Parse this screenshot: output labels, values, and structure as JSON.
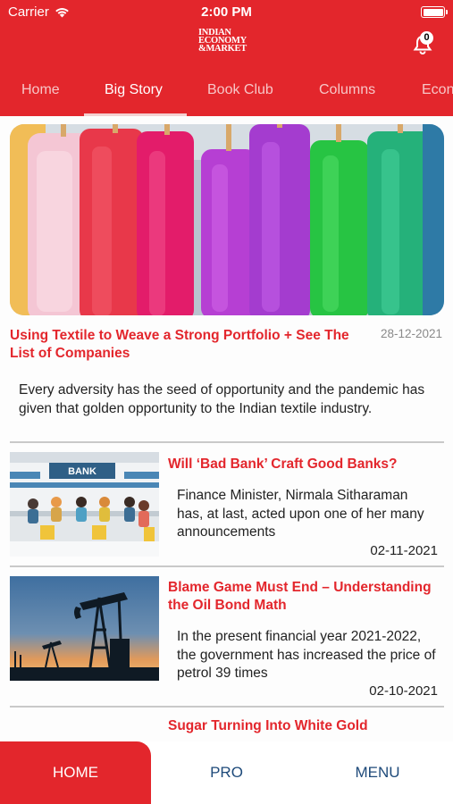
{
  "status_bar": {
    "carrier": "Carrier",
    "time": "2:00 PM"
  },
  "header": {
    "logo_lines": [
      "INDIAN",
      "ECONOMY",
      "&MARKET"
    ],
    "notification_count": "0"
  },
  "tabs": [
    {
      "label": "Home",
      "active": false
    },
    {
      "label": "Big Story",
      "active": true
    },
    {
      "label": "Book Club",
      "active": false
    },
    {
      "label": "Columns",
      "active": false
    },
    {
      "label": "Econ",
      "active": false
    }
  ],
  "hero": {
    "title": "Using Textile to Weave a Strong Portfolio + See The List of Companies",
    "date": "28-12-2021",
    "description": "Every adversity has the seed of opportunity and the pandemic has given that golden opportunity to the Indian textile industry."
  },
  "stories": [
    {
      "title": "Will ‘Bad Bank’ Craft Good Banks?",
      "description": "Finance Minister, Nirmala Sitharaman has, at last, acted upon one of her many announcements",
      "date": "02-11-2021",
      "thumb_sign": "BANK"
    },
    {
      "title": "Blame Game Must End – Understanding the Oil Bond Math",
      "description": "In the present financial year 2021-2022, the government has increased the price of petrol 39 times",
      "date": "02-10-2021"
    },
    {
      "title": "Sugar Turning Into White Gold"
    }
  ],
  "bottom_nav": [
    {
      "label": "HOME",
      "active": true
    },
    {
      "label": "PRO",
      "active": false
    },
    {
      "label": "MENU",
      "active": false
    }
  ],
  "colors": {
    "brand_red": "#e3262c",
    "nav_blue": "#1e4a7a"
  }
}
